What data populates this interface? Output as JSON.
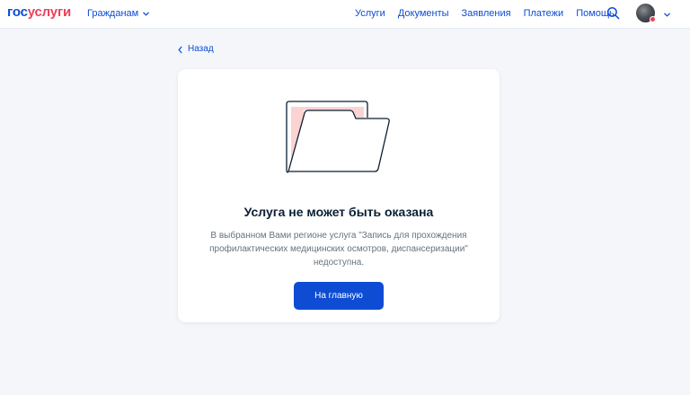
{
  "header": {
    "logo_part1": "гос",
    "logo_part2": "услуги",
    "role": "Гражданам",
    "nav": [
      "Услуги",
      "Документы",
      "Заявления",
      "Платежи",
      "Помощь"
    ],
    "icons": {
      "search": "search-icon",
      "role_chevron": "chevron-down-icon",
      "avatar_chevron": "chevron-down-icon"
    }
  },
  "back": {
    "label": "Назад",
    "icon": "chevron-left-icon"
  },
  "card": {
    "illustration": "folder-icon",
    "title": "Услуга не может быть оказана",
    "description_line1": "В выбранном Вами регионе услуга \"Запись для прохождения",
    "description_line2": "профилактических медицинских осмотров, диспансеризации\"",
    "description_line3": "недоступна.",
    "button_label": "На главную"
  },
  "colors": {
    "brand_blue": "#0d4cd3",
    "brand_red": "#ee3f58",
    "text_dark": "#0b1f33",
    "text_muted": "#66727f",
    "page_bg": "#f4f6fa",
    "folder_pink": "#fbd3d3"
  }
}
